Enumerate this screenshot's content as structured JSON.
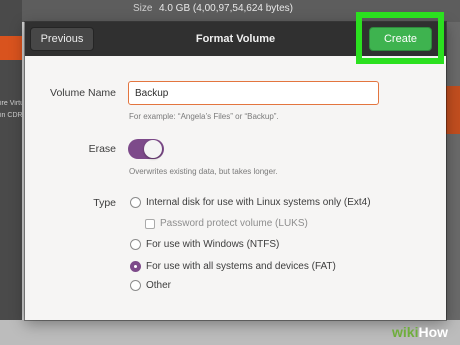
{
  "background": {
    "size_label": "Size",
    "size_value": "4.0 GB (4,00,97,54,624 bytes)",
    "sidebar_fragments": [
      "ire Virtual S",
      "in CDRW"
    ]
  },
  "dialog": {
    "title": "Format Volume",
    "previous_label": "Previous",
    "create_label": "Create",
    "volume_name": {
      "label": "Volume Name",
      "value": "Backup",
      "hint": "For example: “Angela’s Files” or “Backup”."
    },
    "erase": {
      "label": "Erase",
      "enabled": true,
      "hint": "Overwrites existing data, but takes longer."
    },
    "type": {
      "label": "Type",
      "options": [
        {
          "label": "Internal disk for use with Linux systems only (Ext4)",
          "selected": false
        },
        {
          "label": "For use with Windows (NTFS)",
          "selected": false
        },
        {
          "label": "For use with all systems and devices (FAT)",
          "selected": true
        },
        {
          "label": "Other",
          "selected": false
        }
      ],
      "password_checkbox": {
        "label": "Password protect volume (LUKS)",
        "checked": false,
        "enabled": false
      }
    }
  },
  "watermark": {
    "part1": "wiki",
    "part2": "How"
  },
  "colors": {
    "accent": "#7d4a8a",
    "create_button": "#3eb34f",
    "highlight_box": "#2be01f",
    "input_focus": "#e3753f"
  }
}
